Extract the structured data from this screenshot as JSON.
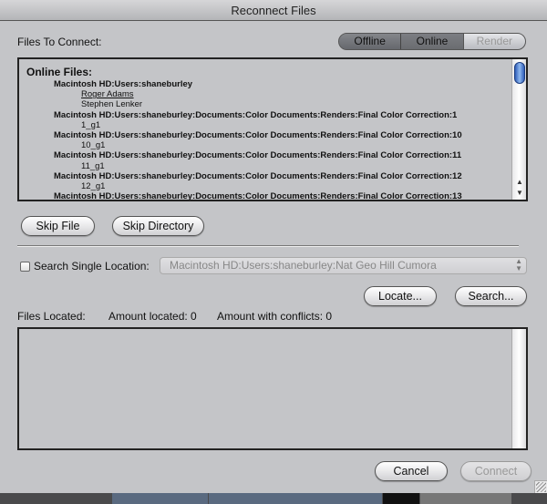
{
  "window": {
    "title": "Reconnect Files"
  },
  "files_to_connect": {
    "label": "Files To Connect:",
    "segments": [
      {
        "label": "Offline",
        "state": "selected"
      },
      {
        "label": "Online",
        "state": "selected"
      },
      {
        "label": "Render",
        "state": "unselected"
      }
    ]
  },
  "online_files": {
    "header": "Online Files:",
    "lines": [
      {
        "text": "Macintosh HD:Users:shaneburley",
        "level": 1
      },
      {
        "text": "Roger Adams",
        "level": 2,
        "underlined": true
      },
      {
        "text": "Stephen Lenker",
        "level": 2
      },
      {
        "text": "Macintosh HD:Users:shaneburley:Documents:Color Documents:Renders:Final Color Correction:1",
        "level": 1
      },
      {
        "text": "1_g1",
        "level": 2
      },
      {
        "text": "Macintosh HD:Users:shaneburley:Documents:Color Documents:Renders:Final Color Correction:10",
        "level": 1
      },
      {
        "text": "10_g1",
        "level": 2
      },
      {
        "text": "Macintosh HD:Users:shaneburley:Documents:Color Documents:Renders:Final Color Correction:11",
        "level": 1
      },
      {
        "text": "11_g1",
        "level": 2
      },
      {
        "text": "Macintosh HD:Users:shaneburley:Documents:Color Documents:Renders:Final Color Correction:12",
        "level": 1
      },
      {
        "text": "12_g1",
        "level": 2
      },
      {
        "text": "Macintosh HD:Users:shaneburley:Documents:Color Documents:Renders:Final Color Correction:13",
        "level": 1
      }
    ]
  },
  "buttons": {
    "skip_file": "Skip File",
    "skip_directory": "Skip Directory",
    "locate": "Locate...",
    "search": "Search...",
    "cancel": "Cancel",
    "connect": "Connect"
  },
  "search_single_location": {
    "label": "Search Single Location:",
    "checked": false,
    "selected_path": "Macintosh HD:Users:shaneburley:Nat Geo Hill Cumora"
  },
  "files_located": {
    "label": "Files Located:",
    "amount_located": "Amount located: 0",
    "amount_conflicts": "Amount with conflicts: 0"
  },
  "icons": {
    "scroll_up": "▲",
    "scroll_down": "▼",
    "popup_chevron": "▲▼"
  }
}
